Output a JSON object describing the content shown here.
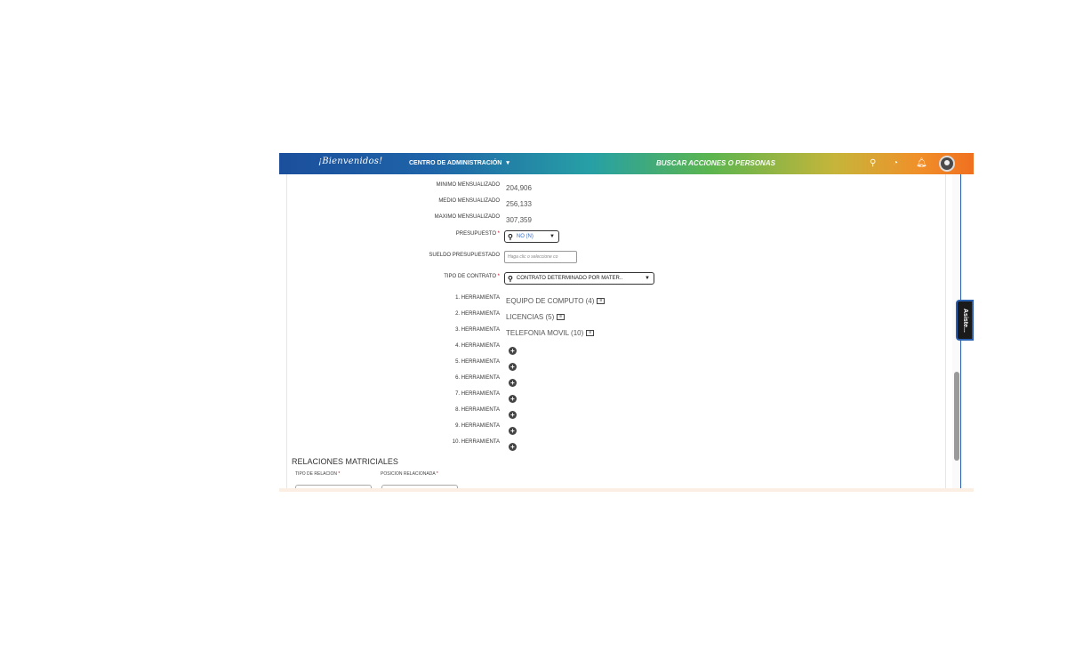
{
  "header": {
    "brand": "¡Bienvenidos!",
    "admin_menu": "CENTRO DE ADMINISTRACIÓN",
    "search_label": "BUSCAR ACCIONES O PERSONAS"
  },
  "assistant_tab": "Asiste...",
  "fields": {
    "min_label": "MINIMO MENSUALIZADO",
    "min_value": "204,906",
    "mid_label": "MEDIO MENSUALIZADO",
    "mid_value": "256,133",
    "max_label": "MAXIMO MENSUALIZADO",
    "max_value": "307,359",
    "budget_label": "PRESUPUESTO",
    "budget_value": "NO (N)",
    "salary_label": "SUELDO PRESUPUESTADO",
    "salary_placeholder": "Haga clic o seleccione co",
    "contract_label": "TIPO DE CONTRATO",
    "contract_value": "CONTRATO DETERMINADO POR MATER..",
    "required_mark": "*"
  },
  "tools": [
    {
      "label": "1. HERRAMIENTA",
      "value": "EQUIPO DE COMPUTO (4)"
    },
    {
      "label": "2. HERRAMIENTA",
      "value": "LICENCIAS (5)"
    },
    {
      "label": "3. HERRAMIENTA",
      "value": "TELEFONIA MOVIL (10)"
    },
    {
      "label": "4. HERRAMIENTA",
      "value": ""
    },
    {
      "label": "5. HERRAMIENTA",
      "value": ""
    },
    {
      "label": "6. HERRAMIENTA",
      "value": ""
    },
    {
      "label": "7. HERRAMIENTA",
      "value": ""
    },
    {
      "label": "8. HERRAMIENTA",
      "value": ""
    },
    {
      "label": "9. HERRAMIENTA",
      "value": ""
    },
    {
      "label": "10. HERRAMIENTA",
      "value": ""
    }
  ],
  "relations": {
    "title": "RELACIONES MATRICIALES",
    "col1": "TIPO DE RELACION",
    "col2": "POSICION RELACIONADA"
  }
}
